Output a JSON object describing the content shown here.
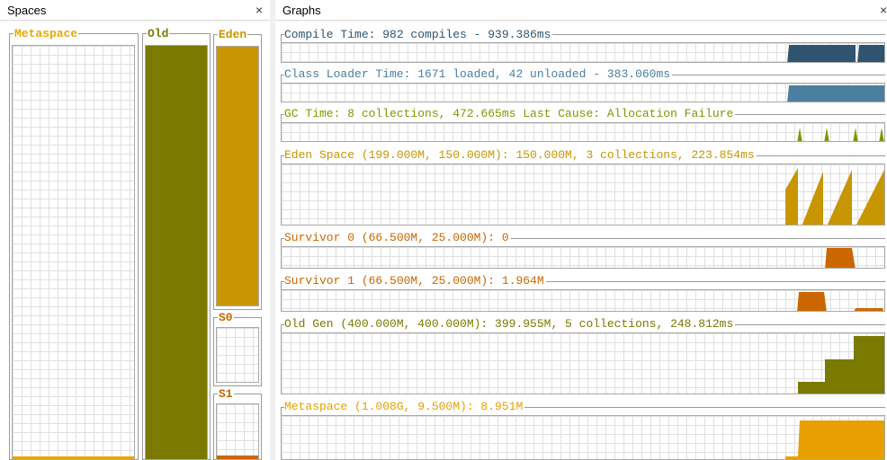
{
  "spaces_panel": {
    "title": "Spaces",
    "close_label": "×"
  },
  "graphs_panel": {
    "title": "Graphs",
    "close_label": "×"
  },
  "spaces": {
    "metaspace": {
      "label": "Metaspace",
      "color": "#e8a800",
      "fill_fraction": 0.005
    },
    "old": {
      "label": "Old",
      "color": "#7a7a00",
      "fill_fraction": 1.0
    },
    "eden": {
      "label": "Eden",
      "color": "#c89600",
      "fill_fraction": 1.0
    },
    "s0": {
      "label": "S0",
      "color": "#cc6600",
      "fill_fraction": 0.0
    },
    "s1": {
      "label": "S1",
      "color": "#cc6600",
      "fill_fraction": 0.05
    }
  },
  "graphs": [
    {
      "id": "compile",
      "title": "Compile Time: 982 compiles - 939.386ms",
      "color": "#2f5470"
    },
    {
      "id": "classloader",
      "title": "Class Loader Time: 1671 loaded, 42 unloaded - 383.060ms",
      "color": "#4a7fa0"
    },
    {
      "id": "gc",
      "title": "GC Time: 8 collections, 472.665ms Last Cause: Allocation Failure",
      "color": "#7a9a00"
    },
    {
      "id": "eden",
      "title": "Eden Space (199.000M, 150.000M): 150.000M, 3 collections, 223.854ms",
      "color": "#c89600"
    },
    {
      "id": "survivor0",
      "title": "Survivor 0 (66.500M, 25.000M): 0",
      "color": "#cc6600"
    },
    {
      "id": "survivor1",
      "title": "Survivor 1 (66.500M, 25.000M): 1.964M",
      "color": "#cc6600"
    },
    {
      "id": "oldgen",
      "title": "Old Gen (400.000M, 400.000M): 399.955M, 5 collections, 248.812ms",
      "color": "#7a7a00"
    },
    {
      "id": "metaspace",
      "title": "Metaspace (1.008G, 9.500M): 8.951M",
      "color": "#e8a000"
    }
  ]
}
